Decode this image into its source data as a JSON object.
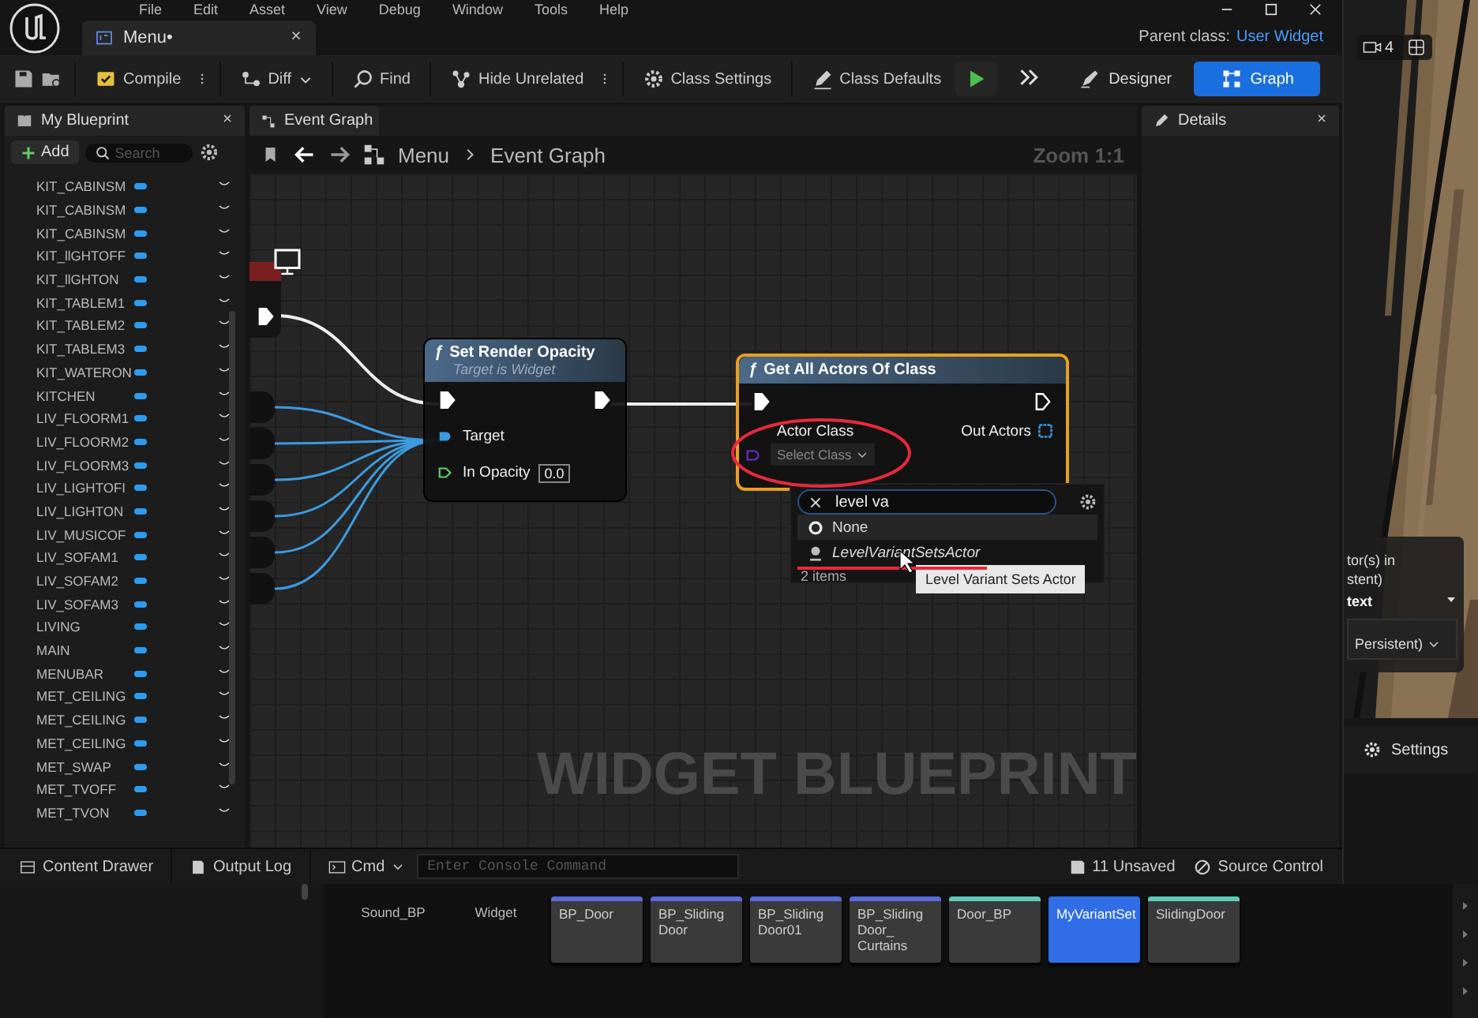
{
  "menu_bar": [
    "File",
    "Edit",
    "Asset",
    "View",
    "Debug",
    "Window",
    "Tools",
    "Help"
  ],
  "document_tab": {
    "label": "Menu•"
  },
  "parent_class": {
    "label": "Parent class:",
    "value": "User Widget"
  },
  "toolbar": {
    "buttons": [
      {
        "label": "Compile"
      },
      {
        "label": "Diff"
      },
      {
        "label": "Find"
      },
      {
        "label": "Hide Unrelated"
      },
      {
        "label": "Class Settings"
      },
      {
        "label": "Class Defaults"
      }
    ],
    "modes": [
      {
        "label": "Designer",
        "selected": false
      },
      {
        "label": "Graph",
        "selected": true
      }
    ]
  },
  "my_blueprint": {
    "tab": "My Blueprint",
    "add": "Add",
    "search_placeholder": "Search",
    "variables": [
      "KIT_CABINSM",
      "KIT_CABINSM",
      "KIT_CABINSM",
      "KIT_llGHTOFF",
      "KIT_llGHTON",
      "KIT_TABLEM1",
      "KIT_TABLEM2",
      "KIT_TABLEM3",
      "KIT_WATERON",
      "KITCHEN",
      "LIV_FLOORM1",
      "LIV_FLOORM2",
      "LIV_FLOORM3",
      "LIV_LIGHTOFI",
      "LIV_LIGHTON",
      "LIV_MUSICOF",
      "LIV_SOFAM1",
      "LIV_SOFAM2",
      "LIV_SOFAM3",
      "LIVING",
      "MAIN",
      "MENUBAR",
      "MET_CEILING",
      "MET_CEILING",
      "MET_CEILING",
      "MET_SWAP",
      "MET_TVOFF",
      "MET_TVON"
    ]
  },
  "graph": {
    "tab": "Event Graph",
    "breadcrumb": [
      "Menu",
      "Event Graph"
    ],
    "zoom": "Zoom 1:1",
    "watermark": "WIDGET BLUEPRINT",
    "set_render_opacity": {
      "function_icon": "ƒ",
      "title": "Set Render Opacity",
      "subtitle": "Target is Widget",
      "target": "Target",
      "opacity_label": "In Opacity",
      "opacity_value": "0.0",
      "selected": false
    },
    "get_all_actors": {
      "function_icon": "ƒ",
      "title": "Get All Actors Of Class",
      "actor_class": "Actor Class",
      "select_class": "Select Class",
      "out_actors": "Out Actors",
      "selected": true
    },
    "class_picker": {
      "search": "level va",
      "options": [
        {
          "label": "None",
          "selected": true
        },
        {
          "label": "LevelVariantSetsActor",
          "selected": false
        }
      ],
      "count": "2 items",
      "tooltip": "Level Variant Sets Actor"
    }
  },
  "details": {
    "tab": "Details"
  },
  "status_bar": {
    "content_drawer": "Content Drawer",
    "output_log": "Output Log",
    "cmd": "Cmd",
    "console_placeholder": "Enter Console Command",
    "unsaved": "11 Unsaved",
    "source_control": "Source Control"
  },
  "viewport": {
    "camera_speed": "4",
    "overlay_lines": [
      "tor(s) in",
      "stent)"
    ],
    "context": "text",
    "level": "Persistent)",
    "settings": "Settings"
  },
  "assets": [
    {
      "name": "Sound_BP",
      "kind": "plain",
      "selected": false
    },
    {
      "name": "Widget",
      "kind": "plain",
      "selected": false
    },
    {
      "name": "BP_Door",
      "kind": "tile",
      "color": "#5a6ad8",
      "selected": false
    },
    {
      "name": "BP_Sliding Door",
      "kind": "tile",
      "color": "#5a6ad8",
      "selected": false
    },
    {
      "name": "BP_Sliding Door01",
      "kind": "tile",
      "color": "#5a6ad8",
      "selected": false
    },
    {
      "name": "BP_Sliding Door_ Curtains",
      "kind": "tile",
      "color": "#5a6ad8",
      "selected": false
    },
    {
      "name": "Door_BP",
      "kind": "tile",
      "color": "#5fc8b8",
      "selected": false
    },
    {
      "name": "MyVariantSet",
      "kind": "tile",
      "color": "#2f6ee6",
      "selected": true
    },
    {
      "name": "SlidingDoor",
      "kind": "tile",
      "color": "#5fc8b8",
      "selected": false
    }
  ]
}
